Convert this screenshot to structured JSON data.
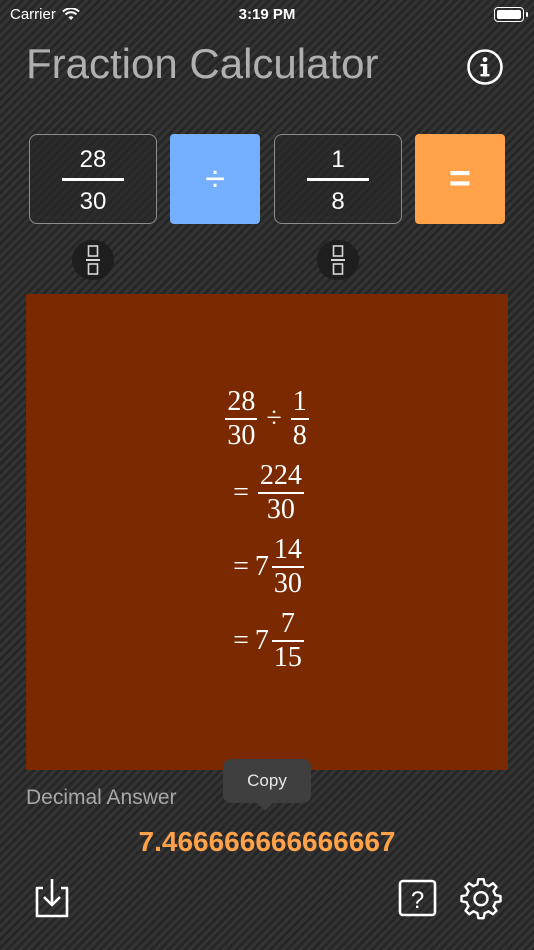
{
  "status_bar": {
    "carrier": "Carrier",
    "time": "3:19 PM"
  },
  "header": {
    "title": "Fraction Calculator"
  },
  "inputs": {
    "first": {
      "numerator": "28",
      "denominator": "30"
    },
    "operator": "÷",
    "second": {
      "numerator": "1",
      "denominator": "8"
    },
    "equals": "="
  },
  "result": {
    "steps": [
      {
        "prefix": "",
        "lhs": {
          "numerator": "28",
          "denominator": "30"
        },
        "operator": "÷",
        "rhs": {
          "numerator": "1",
          "denominator": "8"
        }
      },
      {
        "prefix": "=",
        "fraction": {
          "numerator": "224",
          "denominator": "30"
        }
      },
      {
        "prefix": "=",
        "whole": "7",
        "fraction": {
          "numerator": "14",
          "denominator": "30"
        }
      },
      {
        "prefix": "=",
        "whole": "7",
        "fraction": {
          "numerator": "7",
          "denominator": "15"
        }
      }
    ]
  },
  "tooltip": {
    "copy_label": "Copy"
  },
  "decimal": {
    "label": "Decimal Answer",
    "value": "7.466666666666667"
  },
  "colors": {
    "operator_button": "#74b0ff",
    "equals_button": "#ffa24a",
    "result_panel": "#7a2900",
    "decimal_value": "#ffa24a"
  },
  "icons": {
    "info": "info-icon",
    "fraction_toggle": "fraction-icon",
    "save": "download-icon",
    "help": "help-icon",
    "settings": "gear-icon"
  }
}
